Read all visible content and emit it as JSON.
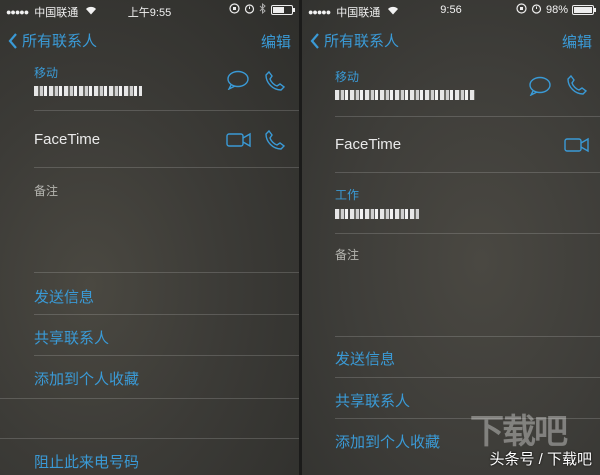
{
  "left": {
    "status": {
      "carrier": "中国联通",
      "time": "上午9:55",
      "battery_level": 0.6
    },
    "nav": {
      "back_label": "所有联系人",
      "edit_label": "编辑"
    },
    "mobile_label": "移动",
    "facetime_label": "FaceTime",
    "notes_label": "备注",
    "actions": [
      "发送信息",
      "共享联系人",
      "添加到个人收藏",
      "阻止此来电号码"
    ]
  },
  "right": {
    "status": {
      "carrier": "中国联通",
      "time": "9:56",
      "battery": "98%",
      "battery_level": 0.98
    },
    "nav": {
      "back_label": "所有联系人",
      "edit_label": "编辑"
    },
    "mobile_label": "移动",
    "facetime_label": "FaceTime",
    "work_label": "工作",
    "notes_label": "备注",
    "actions": [
      "发送信息",
      "共享联系人",
      "添加到个人收藏"
    ]
  },
  "watermark": "头条号 / 下载吧",
  "logo_text": "下载吧",
  "colors": {
    "accent": "#3a9ad6",
    "text": "#eaeaea"
  }
}
